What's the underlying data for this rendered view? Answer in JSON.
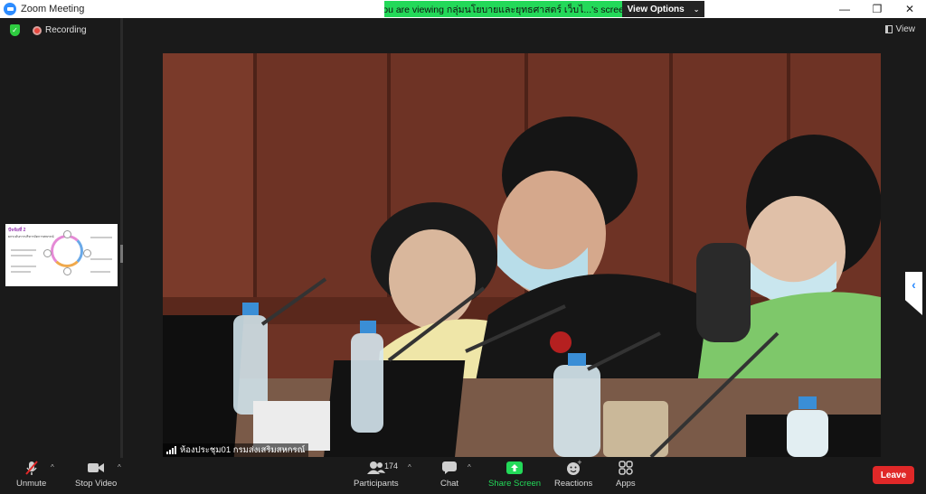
{
  "window": {
    "title": "Zoom Meeting",
    "controls": [
      "—",
      "❐",
      "✕"
    ]
  },
  "share_banner": {
    "text": "You are viewing กลุ่มนโยบายและยุทธศาสตร์ เว็บไ...'s screen",
    "view_options_label": "View Options"
  },
  "status": {
    "recording_label": "Recording",
    "view_label": "View"
  },
  "video": {
    "caption": "ห้องประชุม01 กรมส่งเสริมสหกรณ์"
  },
  "thumbnail": {
    "title": "ปัจจัยที่ 2",
    "subtitle": "ยกระดับการบริหารจัดการสหกรณ์"
  },
  "toolbar": {
    "unmute_label": "Unmute",
    "stop_video_label": "Stop Video",
    "participants_label": "Participants",
    "participants_count": "174",
    "chat_label": "Chat",
    "share_screen_label": "Share Screen",
    "reactions_label": "Reactions",
    "apps_label": "Apps",
    "leave_label": "Leave"
  },
  "colors": {
    "banner_green": "#23d959",
    "leave_red": "#e02828",
    "zoom_blue": "#2d8cff"
  },
  "icons": {
    "shield": "shield-icon",
    "record": "record-icon",
    "mic_off": "mic-muted-icon",
    "video": "video-camera-icon",
    "participants": "participants-icon",
    "chat": "chat-bubble-icon",
    "share": "share-screen-icon",
    "reactions": "emoji-icon",
    "apps": "apps-icon"
  }
}
